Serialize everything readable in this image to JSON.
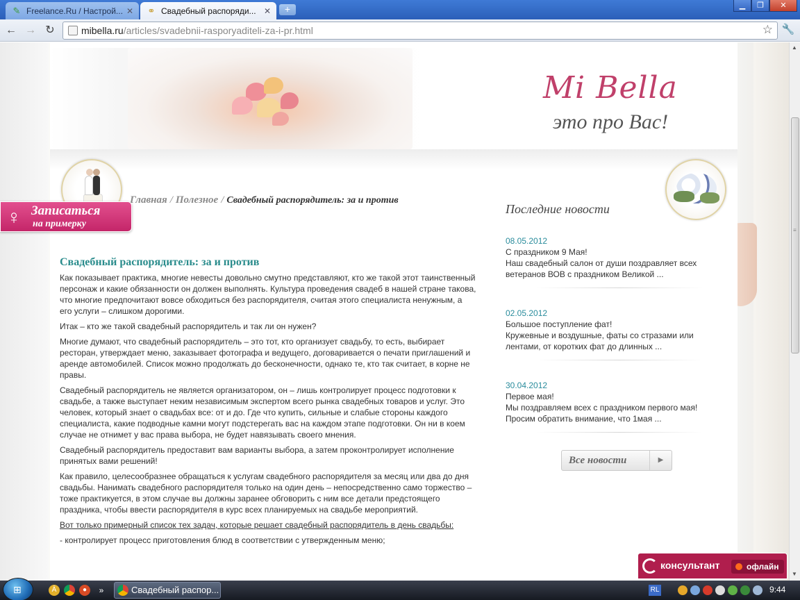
{
  "browser": {
    "tabs": [
      {
        "label": "Freelance.Ru / Настрой...",
        "active": false
      },
      {
        "label": "Свадебный распоряди...",
        "active": true
      }
    ],
    "new_tab_symbol": "+",
    "url_host": "mibella.ru",
    "url_path": "/articles/svadebnii-rasporyaditeli-za-i-pr.html"
  },
  "site": {
    "logo": "Mi Bella",
    "tagline": "это про Вас!"
  },
  "breadcrumb": {
    "home": "Главная",
    "section": "Полезное",
    "current": "Свадебный распорядитель: за и против",
    "separator": "/"
  },
  "article": {
    "title": "Свадебный распорядитель: за и против",
    "paragraphs": [
      "Как показывает практика, многие невесты довольно смутно представляют, кто же такой этот таинственный персонаж и какие обязанности он должен выполнять. Культура проведения свадеб в нашей стране такова, что многие предпочитают вовсе обходиться без распорядителя, считая этого специалиста ненужным, а его услуги – слишком дорогими.",
      "Итак – кто же такой свадебный распорядитель и так ли он нужен?",
      "Многие думают, что свадебный распорядитель – это тот, кто организует свадьбу, то есть, выбирает ресторан, утверждает меню, заказывает фотографа и ведущего, договаривается о печати приглашений и аренде автомобилей. Список можно продолжать до бесконечности, однако те, кто так считает, в корне не правы.",
      "Свадебный распорядитель не является организатором, он – лишь контролирует процесс подготовки к свадьбе, а также выступает неким независимым экспертом всего рынка свадебных товаров и услуг. Это человек, который знает о свадьбах все: от и до. Где что купить, сильные и слабые стороны каждого специалиста, какие подводные камни могут подстерегать вас на каждом этапе подготовки. Он ни в коем случае не отнимет у вас права выбора, не будет навязывать своего мнения.",
      "Свадебный распорядитель предоставит вам варианты выбора, а затем проконтролирует исполнение принятых вами решений!",
      "Как правило, целесообразнее обращаться к услугам свадебного распорядителя за месяц или два до дня свадьбы. Нанимать свадебного распорядителя только на один день – непосредственно само торжество – тоже практикуется, в этом случае вы должны заранее обговорить с ним все детали предстоящего праздника, чтобы ввести распорядителя в курс всех планируемых на свадьбе мероприятий."
    ],
    "list_intro": "Вот только примерный список тех задач, которые решает свадебный распорядитель в день свадьбы:",
    "list_items": [
      "- контролирует процесс приготовления блюд в соответствии с утвержденным меню;"
    ]
  },
  "news": {
    "heading": "Последние новости",
    "items": [
      {
        "date": "08.05.2012",
        "title": "С праздником 9 Мая!",
        "excerpt": "Наш свадебный салон от души поздравляет всех ветеранов ВОВ с праздником Великой ..."
      },
      {
        "date": "02.05.2012",
        "title": "Большое поступление фат!",
        "excerpt": "Кружевные и воздушные, фаты со стразами или лентами, от коротких фат до длинных ..."
      },
      {
        "date": "30.04.2012",
        "title": "Первое мая!",
        "excerpt": "Мы поздравляем всех с праздником первого мая! Просим обратить внимание, что 1мая ..."
      }
    ],
    "all_news_label": "Все новости"
  },
  "signup": {
    "line1": "Записаться",
    "line2": "на примерку"
  },
  "consultant": {
    "label": "консультант",
    "status": "офлайн"
  },
  "taskbar": {
    "task_label": "Свадебный распор...",
    "language": "RL",
    "clock": "9:44"
  },
  "colors": {
    "accent_pink": "#c42669",
    "teal": "#2a8c8c",
    "consultant_bg": "#b01e4d"
  }
}
